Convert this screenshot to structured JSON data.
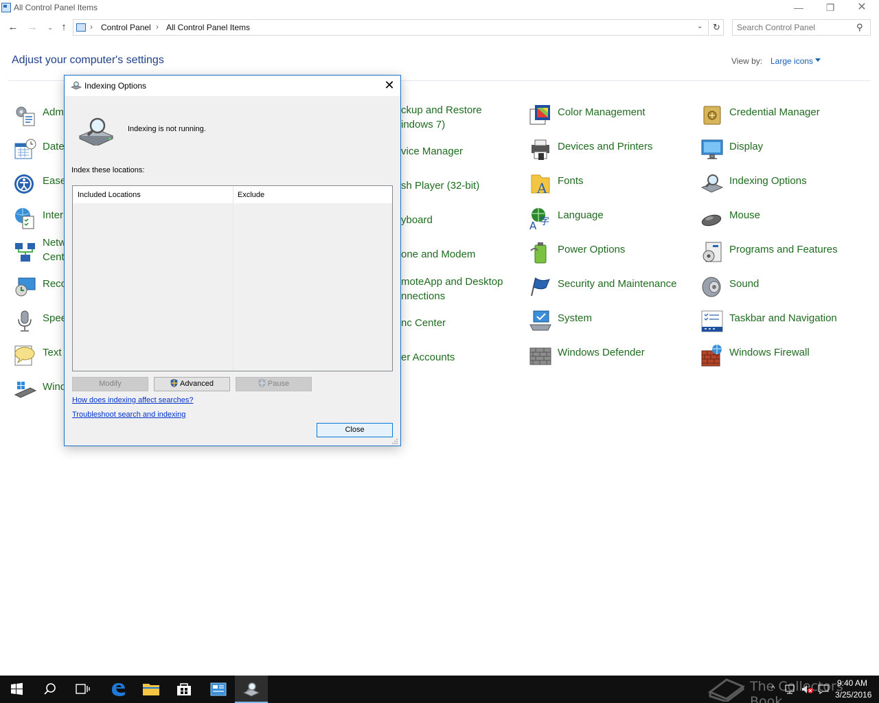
{
  "window": {
    "title": "All Control Panel Items",
    "controls": {
      "minimize": "—",
      "maximize": "❐",
      "close": "✕"
    }
  },
  "nav": {
    "back": "←",
    "forward": "→",
    "recent": "⌄",
    "up": "↑",
    "breadcrumbs": [
      "Control Panel",
      "All Control Panel Items"
    ],
    "separator": "›",
    "dropdown": "⌄",
    "refresh": "↻",
    "search_placeholder": "Search Control Panel",
    "search_icon": "⚲"
  },
  "header": {
    "title": "Adjust your computer's settings",
    "view_by_label": "View by:",
    "view_by_value": "Large icons"
  },
  "items": {
    "col1": [
      "Adm",
      "Date",
      "Ease",
      "Inter",
      "Netw\nCent",
      "Reco",
      "Spee",
      "Text",
      "Wind"
    ],
    "col2": [
      "ckup and Restore\nindows 7)",
      "vice Manager",
      "sh Player (32-bit)",
      "yboard",
      "one and Modem",
      "moteApp and Desktop\nnnections",
      "nc Center",
      "er Accounts"
    ],
    "col3": [
      "Color Management",
      "Devices and Printers",
      "Fonts",
      "Language",
      "Power Options",
      "Security and Maintenance",
      "System",
      "Windows Defender"
    ],
    "col4": [
      "Credential Manager",
      "Display",
      "Indexing Options",
      "Mouse",
      "Programs and Features",
      "Sound",
      "Taskbar and Navigation",
      "Windows Firewall"
    ]
  },
  "dialog": {
    "title": "Indexing Options",
    "close_glyph": "✕",
    "status": "Indexing is not running.",
    "locations_label": "Index these locations:",
    "columns": [
      "Included Locations",
      "Exclude"
    ],
    "rows": [],
    "buttons": {
      "modify": "Modify",
      "advanced": "Advanced",
      "pause": "Pause",
      "close": "Close"
    },
    "links": [
      "How does indexing affect searches?",
      "Troubleshoot search and indexing"
    ]
  },
  "taskbar": {
    "watermark": "The Collectors Book",
    "tray_chevron": "^",
    "time": "9:40 AM",
    "date": "3/25/2016"
  },
  "colors": {
    "link_green": "#1f6b1f",
    "heading_blue": "#1e3f8a",
    "accent_blue": "#0078d7",
    "taskbar": "#101010"
  }
}
